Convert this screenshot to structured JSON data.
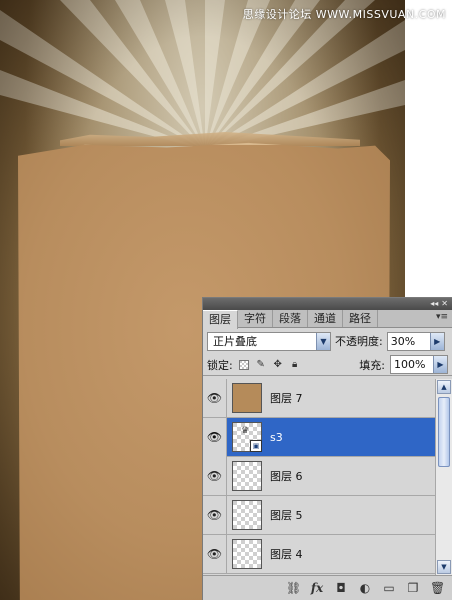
{
  "watermark": "思缘设计论坛 WWW.MISSVUAN.COM",
  "panel": {
    "title_buttons": [
      "◂◂",
      "✕"
    ],
    "tabs": [
      {
        "label": "图层",
        "active": true
      },
      {
        "label": "字符",
        "active": false
      },
      {
        "label": "段落",
        "active": false
      },
      {
        "label": "通道",
        "active": false
      },
      {
        "label": "路径",
        "active": false
      }
    ],
    "tab_menu_icon": "panel-menu-icon",
    "blend_mode": "正片叠底",
    "opacity_label": "不透明度:",
    "opacity_value": "30%",
    "lock_label": "锁定:",
    "fill_label": "填充:",
    "fill_value": "100%",
    "layers": [
      {
        "name": "图层 7",
        "thumb": "paper",
        "visible": true,
        "selected": false
      },
      {
        "name": "s3",
        "thumb": "smart-object",
        "visible": true,
        "selected": true
      },
      {
        "name": "图层 6",
        "thumb": "transparent",
        "visible": true,
        "selected": false
      },
      {
        "name": "图层 5",
        "thumb": "transparent",
        "visible": true,
        "selected": false
      },
      {
        "name": "图层 4",
        "thumb": "transparent",
        "visible": true,
        "selected": false
      }
    ],
    "bottom_icons": [
      "link-icon",
      "fx-icon",
      "mask-icon",
      "adjustment-icon",
      "group-folder-icon",
      "new-layer-icon",
      "trash-icon"
    ],
    "fx_label": "fx"
  }
}
